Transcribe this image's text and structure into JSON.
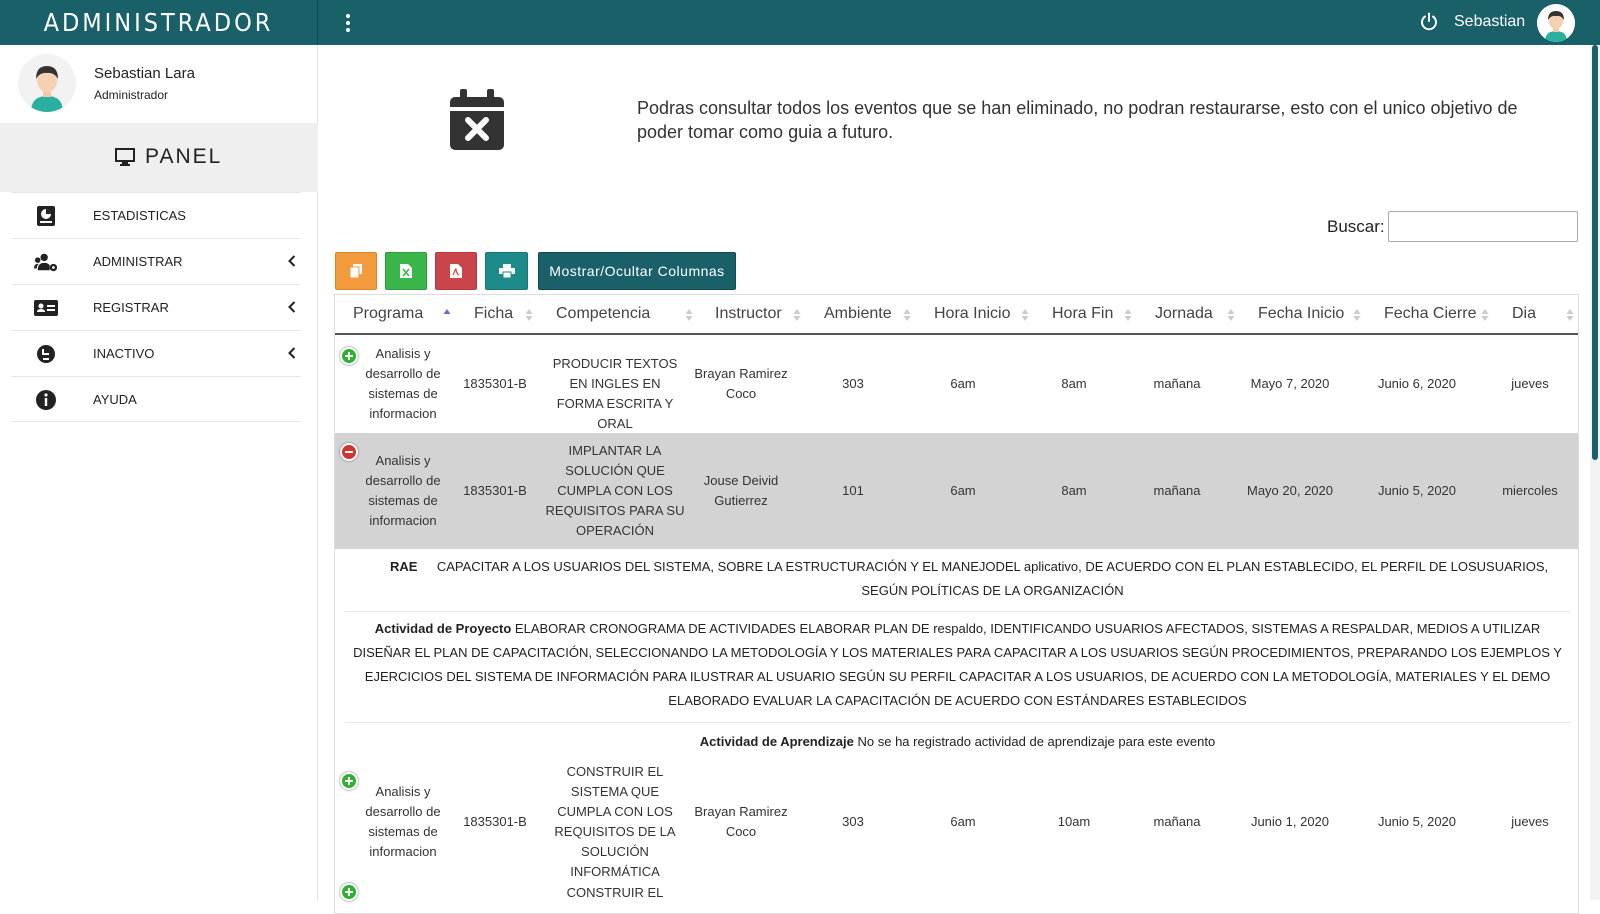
{
  "app": {
    "brand": "ADMINISTRADOR",
    "user_short": "Sebastian"
  },
  "sidebar": {
    "profile_name": "Sebastian Lara",
    "profile_role": "Administrador",
    "panel_label": "PANEL",
    "items": [
      {
        "label": "ESTADISTICAS",
        "icon": "stats-book-icon",
        "chevron": false
      },
      {
        "label": "ADMINISTRAR",
        "icon": "users-cog-icon",
        "chevron": true
      },
      {
        "label": "REGISTRAR",
        "icon": "id-card-icon",
        "chevron": true
      },
      {
        "label": "INACTIVO",
        "icon": "inactive-icon",
        "chevron": true
      },
      {
        "label": "AYUDA",
        "icon": "info-icon",
        "chevron": false
      }
    ]
  },
  "intro": {
    "text": "Podras consultar todos los eventos que se han eliminado, no podran restaurarse, esto con el unico objetivo de poder tomar como guia a futuro."
  },
  "search": {
    "label": "Buscar:",
    "value": ""
  },
  "toolbar": {
    "copy_icon": "copy-icon",
    "excel_icon": "excel-icon",
    "pdf_icon": "pdf-icon",
    "print_icon": "print-icon",
    "columns_label": "Mostrar/Ocultar Columnas"
  },
  "table": {
    "headers": [
      "Programa",
      "Ficha",
      "Competencia",
      "Instructor",
      "Ambiente",
      "Hora Inicio",
      "Hora Fin",
      "Jornada",
      "Fecha Inicio",
      "Fecha Cierre",
      "Dia"
    ],
    "rows": [
      {
        "programa": "Analisis y desarrollo de sistemas de informacion",
        "ficha": "1835301-B",
        "competencia": "PRODUCIR TEXTOS EN INGLES EN FORMA ESCRITA Y ORAL",
        "instructor": "Brayan Ramirez Coco",
        "ambiente": "303",
        "hora_inicio": "6am",
        "hora_fin": "8am",
        "jornada": "mañana",
        "fecha_inicio": "Mayo 7, 2020",
        "fecha_cierre": "Junio 6, 2020",
        "dia": "jueves",
        "expanded": false
      },
      {
        "programa": "Analisis y desarrollo de sistemas de informacion",
        "ficha": "1835301-B",
        "competencia": "IMPLANTAR LA SOLUCIÓN QUE CUMPLA CON LOS REQUISITOS PARA SU OPERACIÓN",
        "instructor": "Jouse Deivid Gutierrez",
        "ambiente": "101",
        "hora_inicio": "6am",
        "hora_fin": "8am",
        "jornada": "mañana",
        "fecha_inicio": "Mayo 20, 2020",
        "fecha_cierre": "Junio 5, 2020",
        "dia": "miercoles",
        "expanded": true
      },
      {
        "programa": "Analisis y desarrollo de sistemas de informacion",
        "ficha": "1835301-B",
        "competencia": "CONSTRUIR EL SISTEMA QUE CUMPLA CON LOS REQUISITOS DE LA SOLUCIÓN INFORMÁTICA",
        "instructor": "Brayan Ramirez Coco",
        "ambiente": "303",
        "hora_inicio": "6am",
        "hora_fin": "10am",
        "jornada": "mañana",
        "fecha_inicio": "Junio 1, 2020",
        "fecha_cierre": "Junio 5, 2020",
        "dia": "jueves",
        "expanded": false
      }
    ],
    "next_row_partial": "CONSTRUIR EL"
  },
  "detail": {
    "rae_label": "RAE",
    "rae_text": "CAPACITAR A LOS USUARIOS DEL SISTEMA, SOBRE LA ESTRUCTURACIÓN Y EL MANEJODEL aplicativo, DE ACUERDO CON EL PLAN ESTABLECIDO, EL PERFIL DE LOSUSUARIOS, SEGÚN POLÍTICAS DE LA ORGANIZACIÓN",
    "proyecto_label": "Actividad de Proyecto",
    "proyecto_text": "ELABORAR CRONOGRAMA DE ACTIVIDADES ELABORAR PLAN DE respaldo, IDENTIFICANDO USUARIOS AFECTADOS, SISTEMAS A RESPALDAR, MEDIOS A UTILIZAR DISEÑAR EL PLAN DE CAPACITACIÓN, SELECCIONANDO LA METODOLOGÍA Y LOS MATERIALES PARA CAPACITAR A LOS USUARIOS SEGÚN PROCEDIMIENTOS, PREPARANDO LOS EJEMPLOS Y EJERCICIOS DEL SISTEMA DE INFORMACIÓN PARA ILUSTRAR AL USUARIO SEGÚN SU PERFIL CAPACITAR A LOS USUARIOS, DE ACUERDO CON LA METODOLOGÍA, MATERIALES Y EL DEMO ELABORADO EVALUAR LA CAPACITACIÓN DE ACUERDO CON ESTÁNDARES ESTABLECIDOS",
    "aprendizaje_label": "Actividad de Aprendizaje",
    "aprendizaje_text": "No se ha registrado actividad de aprendizaje para este evento"
  },
  "colors": {
    "primary": "#1a6068",
    "copy": "#f39a3c",
    "excel": "#39b54a",
    "pdf": "#c9454a",
    "print": "#1f8a8a",
    "expand": "#31b131",
    "collapse": "#d33333"
  }
}
